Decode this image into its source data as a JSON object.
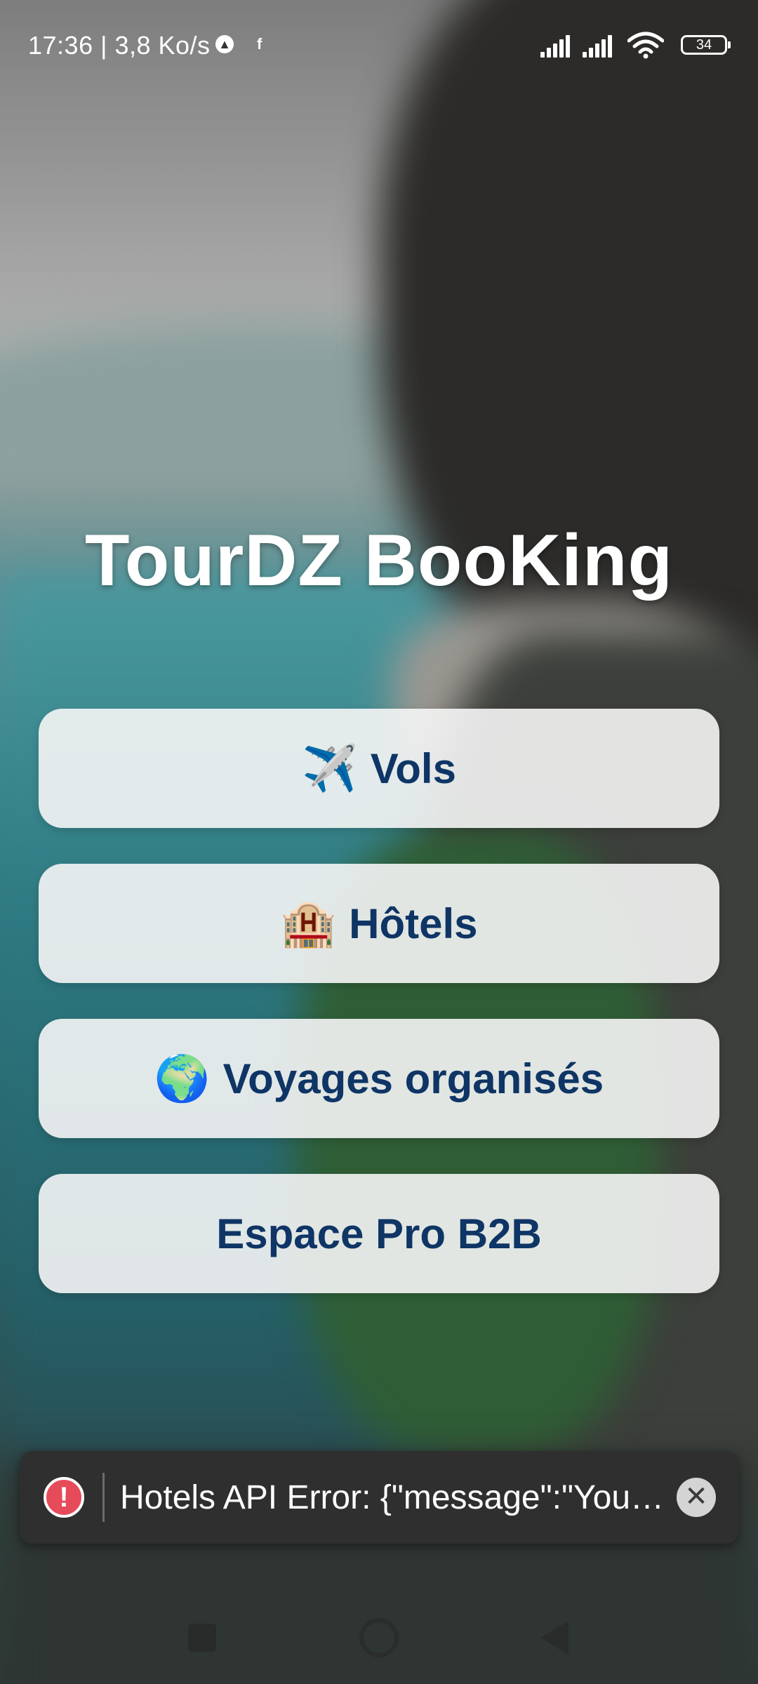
{
  "status_bar": {
    "time_speed": "17:36 | 3,8 Ko/s",
    "notification_icon_1": "vpn-icon",
    "notification_icon_2": "facebook-icon",
    "notification_icon_2_glyph": "f",
    "battery": "34"
  },
  "app": {
    "title": "TourDZ BooKing"
  },
  "menu": [
    {
      "icon": "✈️",
      "icon_name": "airplane-icon",
      "label": "Vols"
    },
    {
      "icon": "🏨",
      "icon_name": "hotel-icon",
      "label": "Hôtels"
    },
    {
      "icon": "🌍",
      "icon_name": "globe-icon",
      "label": "Voyages organisés"
    },
    {
      "icon": "",
      "label": "Espace Pro B2B"
    }
  ],
  "toast": {
    "alert_glyph": "!",
    "message": "Hotels API Error: {\"message\":\"You …",
    "close_glyph": "✕"
  },
  "colors": {
    "button_text": "#0e3565",
    "toast_bg": "#2f2f2f",
    "alert": "#e64b5a"
  }
}
